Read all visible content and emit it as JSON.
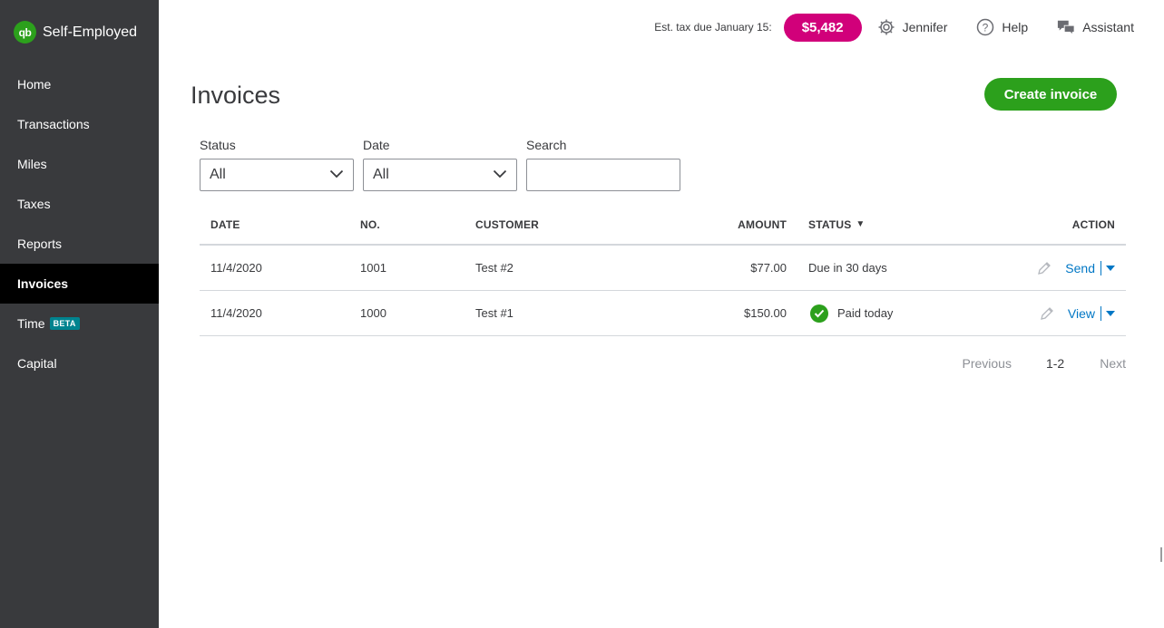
{
  "brand": {
    "name": "Self-Employed",
    "logo_text": "qb"
  },
  "sidebar": {
    "items": [
      {
        "label": "Home",
        "active": false
      },
      {
        "label": "Transactions",
        "active": false
      },
      {
        "label": "Miles",
        "active": false
      },
      {
        "label": "Taxes",
        "active": false
      },
      {
        "label": "Reports",
        "active": false
      },
      {
        "label": "Invoices",
        "active": true
      },
      {
        "label": "Time",
        "badge": "BETA",
        "active": false
      },
      {
        "label": "Capital",
        "active": false
      }
    ]
  },
  "topbar": {
    "tax_label": "Est. tax due January 15:",
    "tax_amount": "$5,482",
    "user": "Jennifer",
    "help": "Help",
    "assistant": "Assistant"
  },
  "page": {
    "title": "Invoices",
    "create_button": "Create invoice"
  },
  "filters": {
    "status": {
      "label": "Status",
      "value": "All"
    },
    "date": {
      "label": "Date",
      "value": "All"
    },
    "search": {
      "label": "Search",
      "value": "",
      "placeholder": ""
    }
  },
  "table": {
    "headers": {
      "date": "DATE",
      "no": "NO.",
      "customer": "CUSTOMER",
      "amount": "AMOUNT",
      "status": "STATUS",
      "status_sort": "▼",
      "action": "ACTION"
    },
    "rows": [
      {
        "date": "11/4/2020",
        "no": "1001",
        "customer": "Test #2",
        "amount": "$77.00",
        "status": "Due in 30 days",
        "paid": false,
        "action": "Send"
      },
      {
        "date": "11/4/2020",
        "no": "1000",
        "customer": "Test #1",
        "amount": "$150.00",
        "status": "Paid today",
        "paid": true,
        "action": "View"
      }
    ]
  },
  "pager": {
    "previous": "Previous",
    "range": "1-2",
    "next": "Next"
  },
  "colors": {
    "sidebar_bg": "#393a3d",
    "active_nav_bg": "#000000",
    "brand_green": "#2ca01c",
    "tax_badge": "#d1007a",
    "link_blue": "#0077c5",
    "beta_teal": "#00838f"
  },
  "icons": {
    "brand": "quickbooks-logo-icon",
    "settings": "gear-icon",
    "help": "help-circle-icon",
    "assistant": "chat-bubbles-icon",
    "dropdown": "chevron-down-icon",
    "edit": "pencil-icon",
    "paid": "check-circle-icon",
    "menu": "caret-down-icon"
  }
}
